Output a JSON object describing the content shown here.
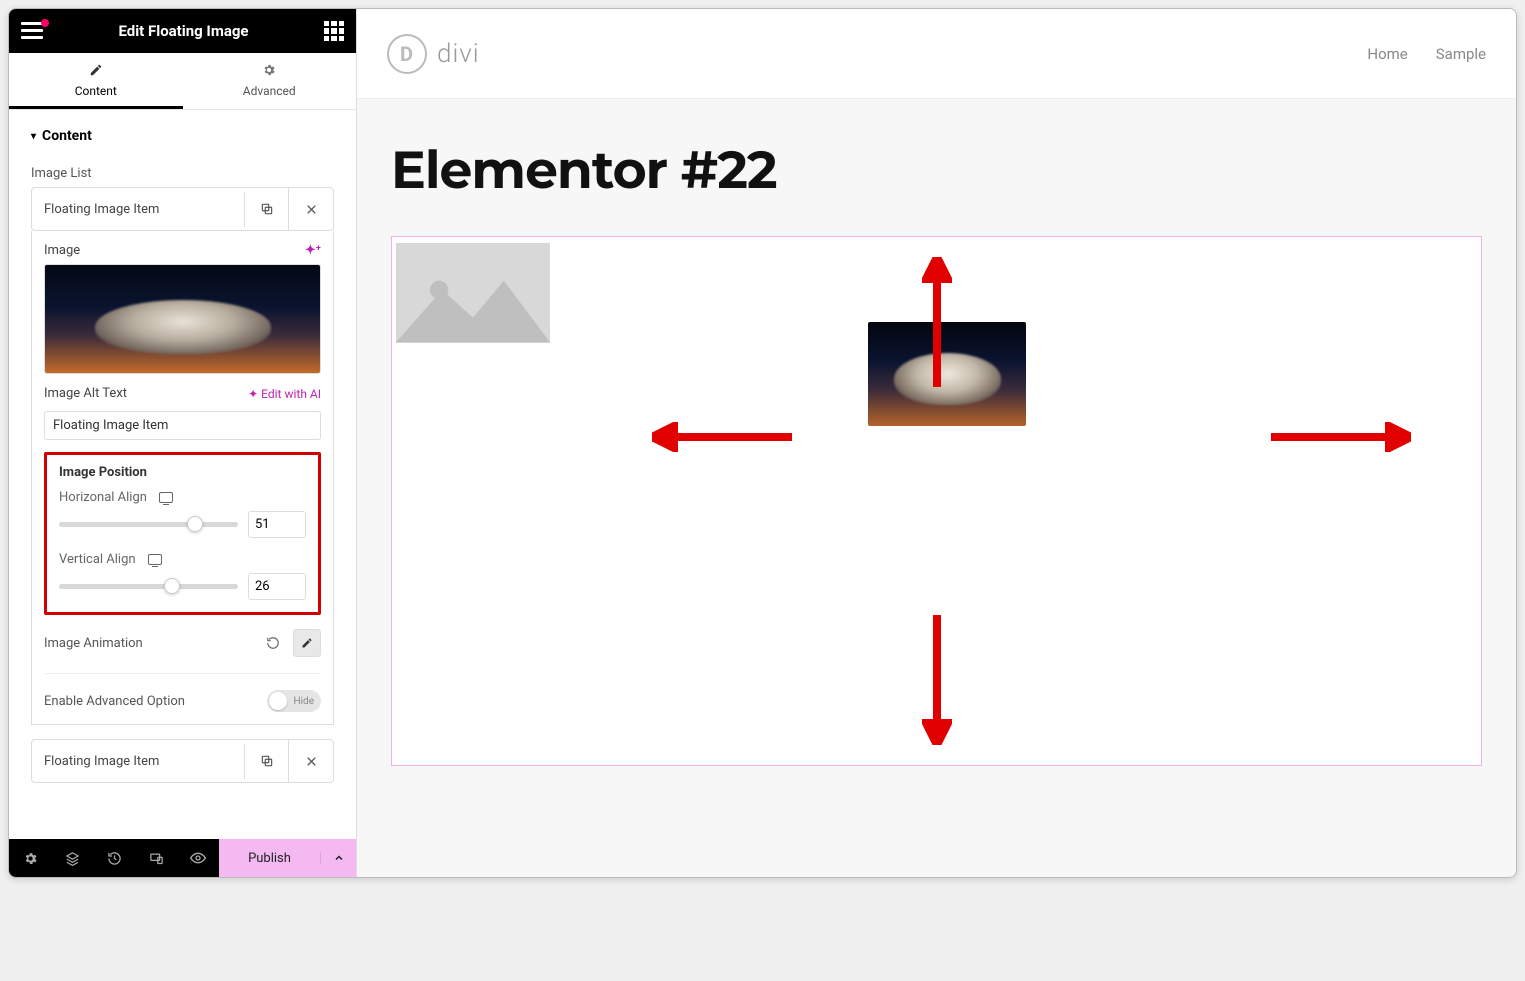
{
  "header": {
    "title": "Edit Floating Image"
  },
  "tabs": {
    "content": "Content",
    "advanced": "Advanced"
  },
  "section": {
    "title": "Content"
  },
  "imageList": {
    "label": "Image List",
    "item1": "Floating Image Item",
    "item2": "Floating Image Item"
  },
  "panel": {
    "imageLabel": "Image",
    "altLabel": "Image Alt Text",
    "altValue": "Floating Image Item",
    "editAI": "Edit with AI"
  },
  "position": {
    "title": "Image Position",
    "hLabel": "Horizonal Align",
    "hValue": "51",
    "vLabel": "Vertical Align",
    "vValue": "26"
  },
  "animation": {
    "label": "Image Animation"
  },
  "advanced": {
    "label": "Enable Advanced Option",
    "toggle": "Hide"
  },
  "footer": {
    "publish": "Publish"
  },
  "site": {
    "logo": "divi",
    "nav1": "Home",
    "nav2": "Sample",
    "pageTitle": "Elementor #22"
  }
}
